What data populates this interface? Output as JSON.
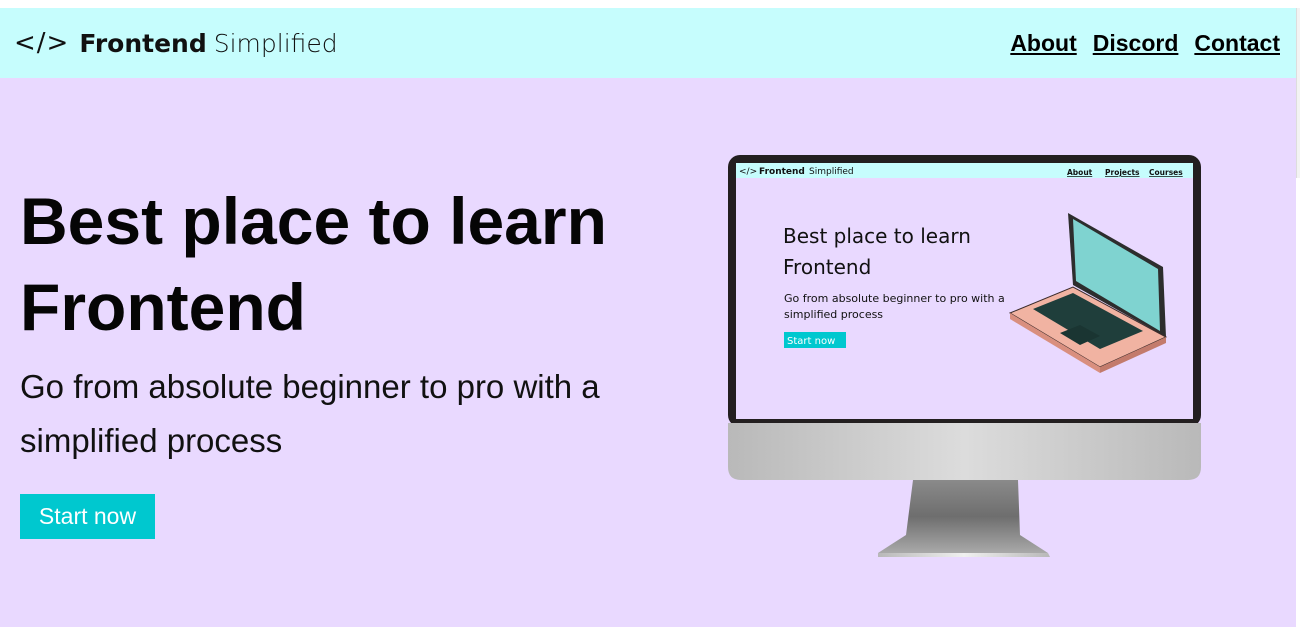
{
  "nav": {
    "logo_icon": "</>",
    "logo_bold": "Frontend",
    "logo_light": "Simplified",
    "links": [
      "About",
      "Discord",
      "Contact"
    ]
  },
  "hero": {
    "title": "Best place to learn Frontend",
    "subtitle": "Go from absolute beginner to pro with a simplified process",
    "cta": "Start now"
  },
  "illustration": {
    "logo_icon": "</>",
    "logo_bold": "Frontend",
    "logo_light": "Simplified",
    "links": [
      "About",
      "Projects",
      "Courses"
    ],
    "title_line1": "Best place to learn",
    "title_line2": "Frontend",
    "subtitle_line1": "Go from absolute beginner to pro with a",
    "subtitle_line2": "simplified process",
    "cta": "Start now"
  },
  "colors": {
    "nav_bg": "#c6fdfd",
    "hero_bg": "#e9d9ff",
    "accent": "#00c8cf"
  }
}
